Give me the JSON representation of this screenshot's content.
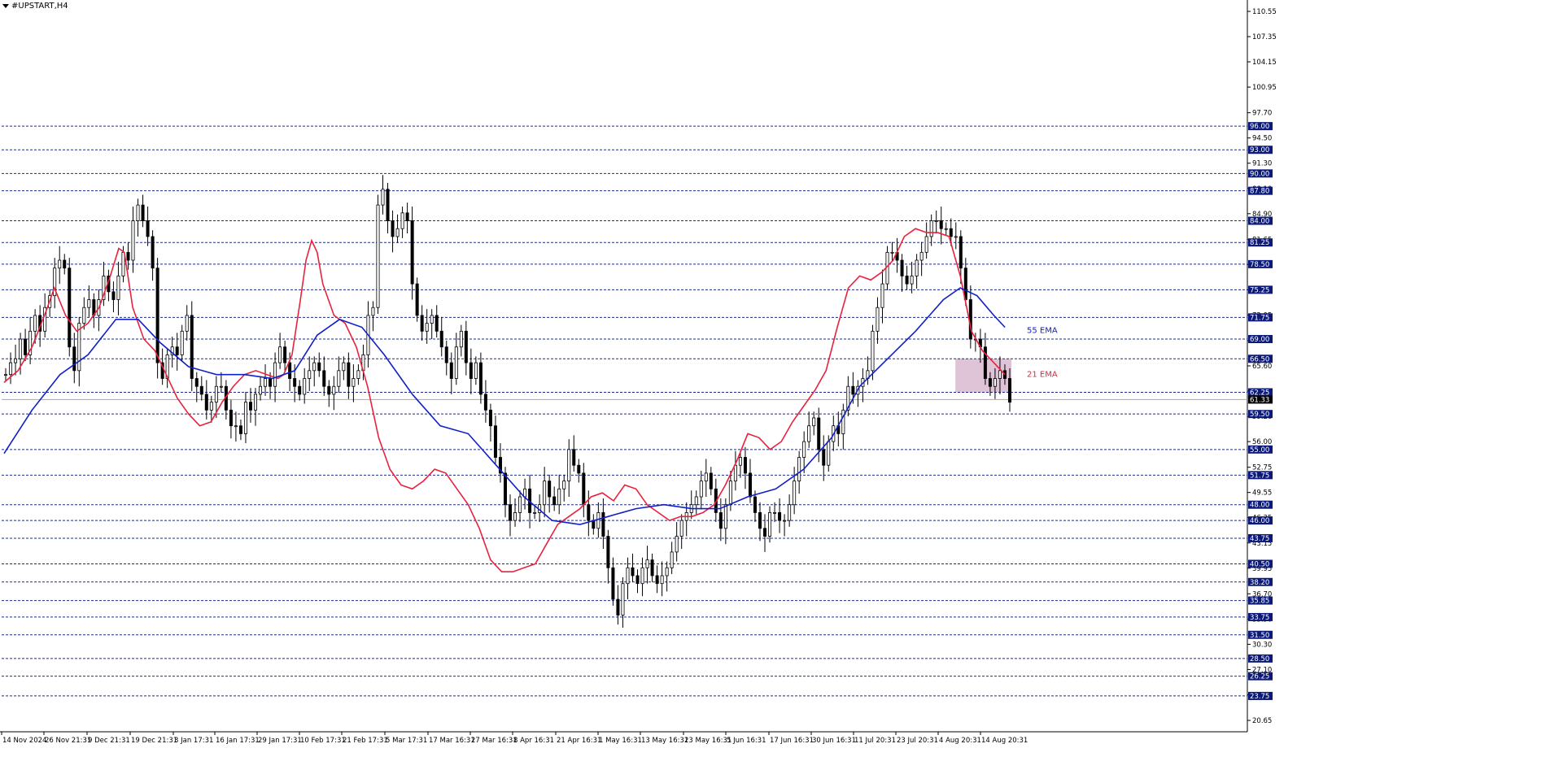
{
  "window": {
    "title": "#UPSTART,H4"
  },
  "colors": {
    "background": "#ffffff",
    "candle": "#000000",
    "ema21": "#e8223c",
    "ema55": "#1020c8",
    "level_line": "#1a2a8a",
    "level_label_bg": "#0b1a7a",
    "level_label_text": "#ffffff",
    "current_price_bg": "#000000",
    "highlight_box": "#d9b8d0"
  },
  "chart_data": {
    "type": "candlestick",
    "title": "#UPSTART,H4",
    "ylim": [
      20.65,
      110.55
    ],
    "y_axis_ticks": [
      "110.55",
      "107.35",
      "104.15",
      "100.95",
      "97.70",
      "94.50",
      "91.30",
      "88.10",
      "84.90",
      "81.65",
      "78.45",
      "75.25",
      "72.05",
      "68.80",
      "65.60",
      "62.40",
      "59.20",
      "56.00",
      "52.75",
      "49.55",
      "46.35",
      "43.15",
      "39.95",
      "36.70",
      "33.50",
      "30.30",
      "27.10",
      "23.90",
      "20.65"
    ],
    "x_axis_labels": [
      "14 Nov 2024",
      "26 Nov 21:31",
      "9 Dec 21:31",
      "19 Dec 21:31",
      "3 Jan 17:31",
      "16 Jan 17:31",
      "29 Jan 17:31",
      "10 Feb 17:31",
      "21 Feb 17:31",
      "5 Mar 17:31",
      "17 Mar 16:31",
      "27 Mar 16:31",
      "8 Apr 16:31",
      "21 Apr 16:31",
      "1 May 16:31",
      "13 May 16:31",
      "23 May 16:31",
      "5 Jun 16:31",
      "17 Jun 16:31",
      "30 Jun 16:31",
      "11 Jul 20:31",
      "23 Jul 20:31",
      "4 Aug 20:31",
      "14 Aug 20:31"
    ],
    "horizontal_levels": [
      96.0,
      93.0,
      90.0,
      87.8,
      84.0,
      81.25,
      78.5,
      75.25,
      71.75,
      69.0,
      66.5,
      62.25,
      59.5,
      55.0,
      51.75,
      48.0,
      46.0,
      43.75,
      40.5,
      38.2,
      35.85,
      33.75,
      31.5,
      28.5,
      26.25,
      23.75
    ],
    "current_price": 61.33,
    "series": [
      {
        "name": "21 EMA",
        "type": "line",
        "color": "#e8223c",
        "values": [
          [
            0,
            63.5
          ],
          [
            5,
            65
          ],
          [
            10,
            68
          ],
          [
            15,
            72.5
          ],
          [
            18,
            75.5
          ],
          [
            22,
            72
          ],
          [
            26,
            70
          ],
          [
            30,
            71
          ],
          [
            34,
            73
          ],
          [
            38,
            77
          ],
          [
            41,
            80.5
          ],
          [
            43,
            80
          ],
          [
            46,
            73
          ],
          [
            50,
            69
          ],
          [
            54,
            67.5
          ],
          [
            58,
            64.5
          ],
          [
            62,
            61.5
          ],
          [
            66,
            59.5
          ],
          [
            70,
            58
          ],
          [
            74,
            58.5
          ],
          [
            78,
            61
          ],
          [
            82,
            63
          ],
          [
            86,
            64.5
          ],
          [
            90,
            65
          ],
          [
            94,
            64.5
          ],
          [
            98,
            64
          ],
          [
            100,
            64.5
          ],
          [
            103,
            67
          ],
          [
            106,
            74
          ],
          [
            108,
            79
          ],
          [
            110,
            81.5
          ],
          [
            112,
            80
          ],
          [
            114,
            76
          ],
          [
            118,
            72
          ],
          [
            122,
            71
          ],
          [
            126,
            68
          ],
          [
            130,
            63
          ],
          [
            134,
            56.5
          ],
          [
            138,
            52.5
          ],
          [
            142,
            50.5
          ],
          [
            146,
            50
          ],
          [
            150,
            51
          ],
          [
            154,
            52.5
          ],
          [
            158,
            52
          ],
          [
            162,
            50
          ],
          [
            166,
            48
          ],
          [
            170,
            45
          ],
          [
            174,
            41
          ],
          [
            178,
            39.5
          ],
          [
            182,
            39.5
          ],
          [
            186,
            40
          ],
          [
            190,
            40.5
          ],
          [
            194,
            43
          ],
          [
            198,
            45.5
          ],
          [
            202,
            46.5
          ],
          [
            206,
            47.5
          ],
          [
            210,
            49
          ],
          [
            214,
            49.5
          ],
          [
            218,
            48.5
          ],
          [
            222,
            50.5
          ],
          [
            226,
            50
          ],
          [
            230,
            48
          ],
          [
            234,
            47
          ],
          [
            238,
            46
          ],
          [
            242,
            46.5
          ],
          [
            246,
            46.5
          ],
          [
            250,
            47
          ],
          [
            254,
            48
          ],
          [
            258,
            50.5
          ],
          [
            262,
            53.5
          ],
          [
            266,
            57
          ],
          [
            270,
            56.5
          ],
          [
            274,
            55
          ],
          [
            278,
            56
          ],
          [
            282,
            58.5
          ],
          [
            286,
            60.5
          ],
          [
            290,
            62.5
          ],
          [
            294,
            65
          ],
          [
            298,
            70.5
          ],
          [
            302,
            75.5
          ],
          [
            306,
            77
          ],
          [
            310,
            76.5
          ],
          [
            314,
            77.5
          ],
          [
            318,
            79
          ],
          [
            322,
            82
          ],
          [
            326,
            83
          ],
          [
            330,
            82.5
          ],
          [
            334,
            82.5
          ],
          [
            338,
            82
          ],
          [
            342,
            77
          ],
          [
            346,
            70
          ],
          [
            350,
            67.5
          ],
          [
            354,
            66
          ],
          [
            358,
            64.5
          ]
        ]
      },
      {
        "name": "55 EMA",
        "type": "line",
        "color": "#1020c8",
        "values": [
          [
            0,
            54.5
          ],
          [
            10,
            60
          ],
          [
            20,
            64.5
          ],
          [
            30,
            67
          ],
          [
            40,
            71.5
          ],
          [
            48,
            71.5
          ],
          [
            56,
            68.5
          ],
          [
            66,
            65.5
          ],
          [
            76,
            64.5
          ],
          [
            86,
            64.5
          ],
          [
            96,
            64
          ],
          [
            104,
            65
          ],
          [
            112,
            69.5
          ],
          [
            120,
            71.5
          ],
          [
            128,
            70.5
          ],
          [
            136,
            67
          ],
          [
            146,
            62
          ],
          [
            156,
            58
          ],
          [
            166,
            57
          ],
          [
            176,
            53
          ],
          [
            186,
            49
          ],
          [
            196,
            46
          ],
          [
            206,
            45.5
          ],
          [
            216,
            46.5
          ],
          [
            226,
            47.5
          ],
          [
            236,
            48
          ],
          [
            246,
            47.5
          ],
          [
            256,
            47.5
          ],
          [
            266,
            49
          ],
          [
            276,
            50
          ],
          [
            286,
            52.5
          ],
          [
            296,
            56.5
          ],
          [
            306,
            63
          ],
          [
            316,
            66.5
          ],
          [
            326,
            70
          ],
          [
            336,
            74
          ],
          [
            342,
            75.5
          ],
          [
            348,
            74.5
          ],
          [
            354,
            72
          ],
          [
            358,
            70.5
          ]
        ]
      },
      {
        "name": "candles",
        "type": "candlestick",
        "values": [
          64.5,
          66,
          66.5,
          69,
          67,
          70,
          72,
          70,
          73,
          74.5,
          78,
          79,
          78,
          68,
          65,
          71,
          73,
          74,
          72,
          74,
          77,
          75,
          74,
          77,
          80,
          79,
          84,
          86,
          84,
          82,
          78,
          66,
          64,
          67,
          68,
          67,
          70,
          72,
          64,
          63,
          62,
          60,
          61,
          63,
          63,
          60,
          58,
          58,
          57,
          61,
          60,
          62,
          63,
          64,
          63,
          66,
          68,
          66,
          64,
          63,
          62,
          64,
          65,
          66,
          65,
          63,
          62,
          63,
          65,
          66,
          63,
          64,
          65,
          67,
          72,
          73,
          86,
          88,
          84,
          82,
          83,
          85,
          84,
          76,
          72,
          70,
          71,
          72,
          70,
          68,
          66,
          64,
          68,
          70,
          66,
          64,
          66,
          62,
          60,
          58,
          54,
          52,
          48,
          46,
          47,
          49,
          50,
          47,
          47,
          48,
          51,
          49,
          48,
          50,
          51,
          55,
          53,
          52,
          48,
          46,
          45,
          47,
          44,
          40,
          36,
          34,
          38,
          40,
          39,
          38,
          40,
          41,
          39,
          38,
          39,
          40,
          42,
          44,
          46,
          47,
          48,
          49,
          51,
          52,
          50,
          47,
          45,
          48,
          51,
          53,
          54,
          52,
          49,
          47,
          45,
          44,
          47,
          47,
          46,
          46,
          48,
          51,
          54,
          56,
          58,
          59,
          55,
          53,
          56,
          58,
          57,
          60,
          63,
          62,
          63,
          64,
          65,
          70,
          73,
          76,
          80,
          80,
          79,
          77,
          76,
          77,
          79,
          80,
          82,
          84,
          84,
          83,
          83,
          82,
          82,
          78,
          74,
          69,
          69,
          68,
          64,
          63,
          64,
          65,
          64,
          61
        ]
      }
    ],
    "annotations": [
      {
        "text": "55 EMA",
        "color": "#1020c8"
      },
      {
        "text": "21 EMA",
        "color": "#e8223c"
      }
    ],
    "highlight_box": {
      "y_range": [
        62.25,
        66.5
      ],
      "x_index_range": [
        342,
        358
      ]
    },
    "grid": false
  }
}
